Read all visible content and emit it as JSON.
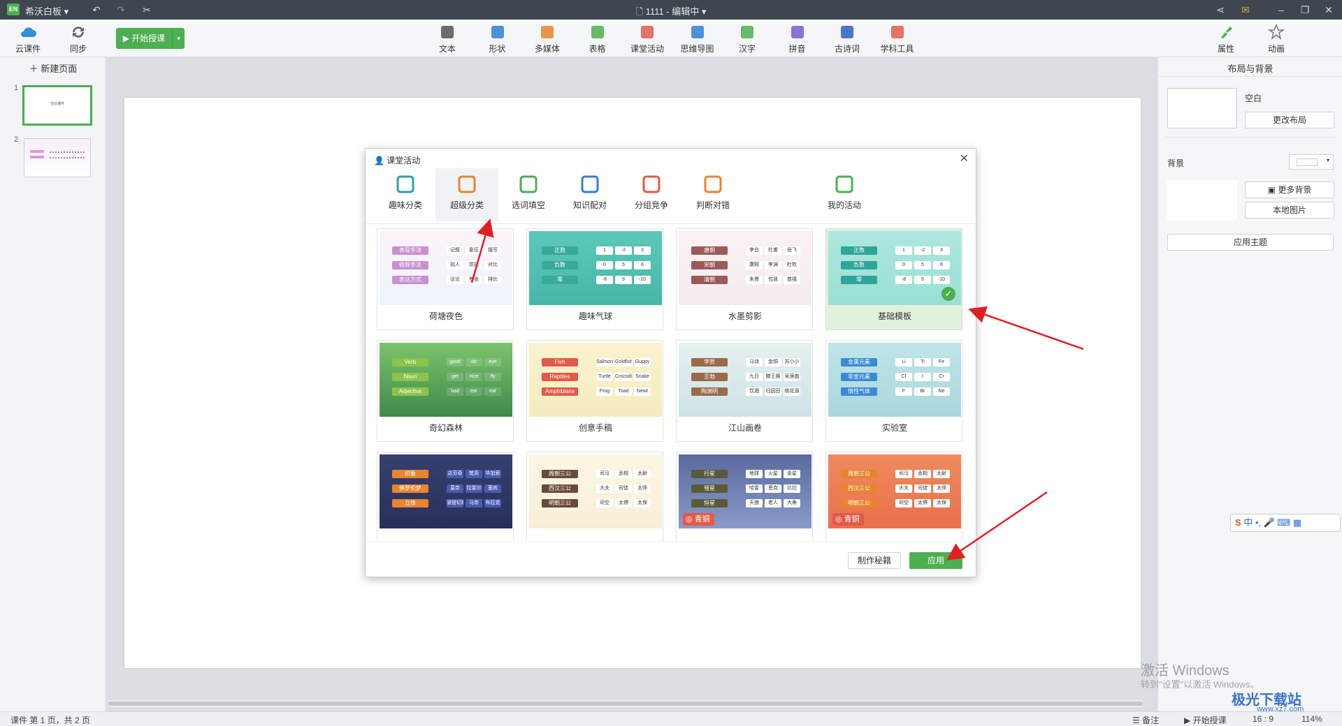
{
  "titlebar": {
    "app_name": "希沃白板",
    "logo_text": "EN",
    "document_title": "1111 - 编辑中"
  },
  "toolbar": {
    "left": [
      {
        "label": "云课件",
        "icon": "cloud-icon"
      },
      {
        "label": "同步",
        "icon": "sync-icon"
      }
    ],
    "start_label": "开始授课",
    "center": [
      {
        "label": "文本",
        "icon": "text-icon"
      },
      {
        "label": "形状",
        "icon": "shape-icon"
      },
      {
        "label": "多媒体",
        "icon": "media-icon"
      },
      {
        "label": "表格",
        "icon": "table-icon"
      },
      {
        "label": "课堂活动",
        "icon": "classroom-activity-icon"
      },
      {
        "label": "思维导图",
        "icon": "mindmap-icon"
      },
      {
        "label": "汉字",
        "icon": "hanzi-icon"
      },
      {
        "label": "拼音",
        "icon": "pinyin-icon"
      },
      {
        "label": "古诗词",
        "icon": "poetry-icon"
      },
      {
        "label": "学科工具",
        "icon": "subject-tools-icon"
      }
    ],
    "right": [
      {
        "label": "属性",
        "icon": "properties-icon"
      },
      {
        "label": "动画",
        "icon": "animation-icon"
      }
    ]
  },
  "leftpanel": {
    "new_page": "新建页面",
    "thumbnails": [
      {
        "num": "1",
        "text": "空白课件"
      },
      {
        "num": "2",
        "text": ""
      }
    ]
  },
  "rightpanel": {
    "title": "布局与背景",
    "layout_name": "空白",
    "change_layout": "更改布局",
    "bg_label": "背景",
    "more_bg": "更多背景",
    "local_image": "本地图片",
    "apply_theme": "应用主题"
  },
  "statusbar": {
    "page_info": "课件 第 1 页，共 2 页",
    "notes": "备注",
    "start": "开始授课",
    "ratio": "16 : 9",
    "zoom": "114%"
  },
  "dialog": {
    "title": "课堂活动",
    "tabs": [
      {
        "label": "趣味分类",
        "icon": "fun-classify-icon"
      },
      {
        "label": "超级分类",
        "icon": "super-classify-icon"
      },
      {
        "label": "选词填空",
        "icon": "fill-blank-icon"
      },
      {
        "label": "知识配对",
        "icon": "knowledge-pair-icon"
      },
      {
        "label": "分组竞争",
        "icon": "group-vs-icon"
      },
      {
        "label": "判断对错",
        "icon": "true-false-icon"
      },
      {
        "label": "我的活动",
        "icon": "my-activity-icon"
      }
    ],
    "templates": [
      {
        "name": "荷塘夜色",
        "tags": [
          "表现手法",
          "修辞手法",
          "表达方式"
        ],
        "words": [
          "记叙",
          "象征",
          "描写",
          "拟人",
          "烘托",
          "对比",
          "议论",
          "夸张",
          "排比"
        ]
      },
      {
        "name": "趣味气球",
        "tags": [
          "正数",
          "负数",
          "零"
        ],
        "words": [
          "1",
          "-2",
          "3",
          "0",
          "5",
          "6",
          "-8",
          "9",
          "-10"
        ]
      },
      {
        "name": "水墨剪影",
        "tags": [
          "唐朝",
          "宋朝",
          "清朝"
        ],
        "words": [
          "李白",
          "杜甫",
          "岳飞",
          "康熙",
          "李渊",
          "杜牧",
          "朱熹",
          "包拯",
          "慈禧"
        ]
      },
      {
        "name": "基础模板",
        "tags": [
          "正数",
          "负数",
          "零"
        ],
        "words": [
          "1",
          "-2",
          "3",
          "0",
          "5",
          "6",
          "-8",
          "9",
          "-10"
        ]
      },
      {
        "name": "奇幻森林",
        "tags": [
          "Verb",
          "Noun",
          "Adjective"
        ],
        "words": [
          "good",
          "do",
          "eye",
          "get",
          "nice",
          "fly",
          "bad",
          "ear",
          "eat"
        ]
      },
      {
        "name": "创意手稿",
        "tags": [
          "Fish",
          "Reptiles",
          "Amphibians"
        ],
        "words": [
          "Salmon",
          "Goldfish",
          "Guppy",
          "Turtle",
          "Crocodile",
          "Snake",
          "Frog",
          "Toad",
          "Newt"
        ]
      },
      {
        "name": "江山画卷",
        "tags": [
          "李贺",
          "王勃",
          "陶渊明"
        ],
        "words": [
          "马诗",
          "金铜",
          "苏小小",
          "九日",
          "滕王阁",
          "采莲曲",
          "饮酒",
          "归园田",
          "桃花源"
        ]
      },
      {
        "name": "实验室",
        "tags": [
          "金属元素",
          "非金元素",
          "惰性气体"
        ],
        "words": [
          "Li",
          "Ti",
          "Fe",
          "Cl",
          "I",
          "Cr",
          "F",
          "Br",
          "Ne"
        ]
      },
      {
        "name": "",
        "tags": [
          "印象",
          "佛罗伦萨",
          "立体"
        ],
        "words": [
          "达芬奇",
          "梵高",
          "毕加索",
          "莫奈",
          "拉斐尔",
          "塞尚",
          "波提切利",
          "马奈",
          "布拉克"
        ]
      },
      {
        "name": "",
        "tags": [
          "周朝三公",
          "西汉三公",
          "明朝三公"
        ],
        "words": [
          "司马",
          "丞相",
          "太尉",
          "大夫",
          "司徒",
          "太师",
          "司空",
          "太傅",
          "太保"
        ]
      },
      {
        "name": "",
        "tags": [
          "行星",
          "彗星",
          "恒星"
        ],
        "words": [
          "地球",
          "火星",
          "金星",
          "哈雷",
          "恩克",
          "比拉",
          "天狼",
          "老人",
          "大角"
        ],
        "badge": "青铜"
      },
      {
        "name": "",
        "tags": [
          "周朝三公",
          "西汉三公",
          "明朝三公"
        ],
        "words": [
          "司马",
          "丞相",
          "太尉",
          "大夫",
          "司徒",
          "太师",
          "司空",
          "太傅",
          "太保"
        ],
        "badge": "青铜"
      }
    ],
    "selected_template": "基础模板",
    "make_tips": "制作秘籍",
    "apply": "应用"
  },
  "overlay": {
    "activate_windows": "激活 Windows",
    "activate_hint": "转到\"设置\"以激活 Windows。",
    "site": "极光下载站",
    "site_url": "www.xz7.com",
    "ime": "中"
  }
}
